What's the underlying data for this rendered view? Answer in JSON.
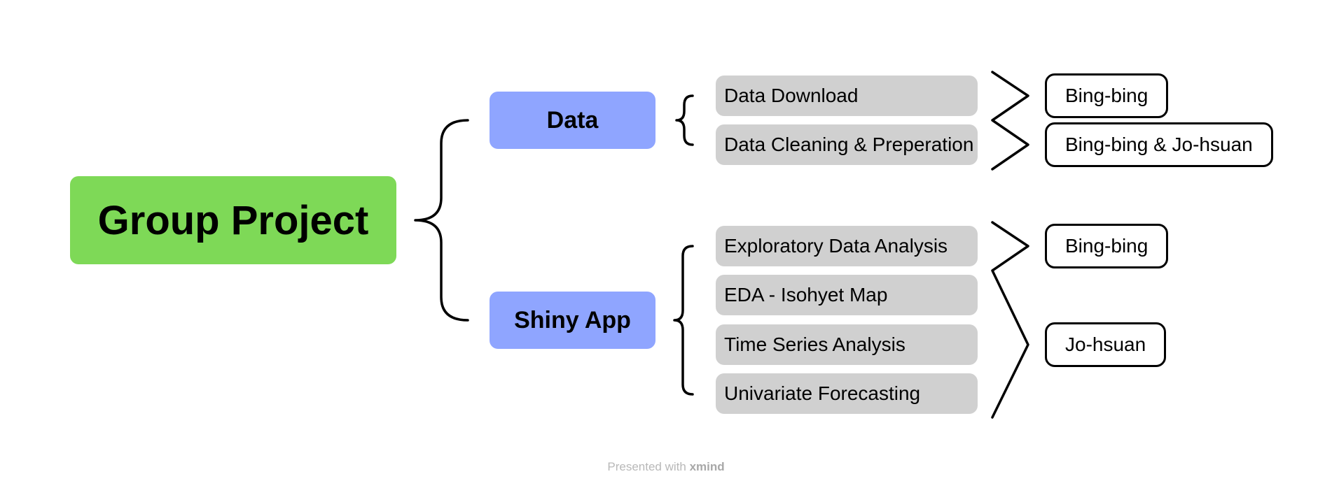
{
  "colors": {
    "root_fill": "#7ed957",
    "main_fill": "#8fa5ff",
    "sub_fill": "#d0d0d0",
    "person_fill": "#ffffff",
    "line": "#000000"
  },
  "root": {
    "label": "Group Project"
  },
  "branches": [
    {
      "label": "Data",
      "items": [
        "Data Download",
        "Data Cleaning & Preperation"
      ]
    },
    {
      "label": "Shiny App",
      "items": [
        "Exploratory Data Analysis",
        "EDA - Isohyet Map",
        "Time Series Analysis",
        "Univariate Forecasting"
      ]
    }
  ],
  "assignees": [
    {
      "name": "Bing-bing",
      "tasks": [
        "Data Download"
      ]
    },
    {
      "name": "Bing-bing & Jo-hsuan",
      "tasks": [
        "Data Cleaning & Preperation"
      ]
    },
    {
      "name": "Bing-bing",
      "tasks": [
        "Exploratory Data Analysis"
      ]
    },
    {
      "name": "Jo-hsuan",
      "tasks": [
        "EDA - Isohyet Map",
        "Time Series Analysis",
        "Univariate Forecasting"
      ]
    }
  ],
  "footer": {
    "prefix": "Presented with",
    "brand": "xmind"
  }
}
